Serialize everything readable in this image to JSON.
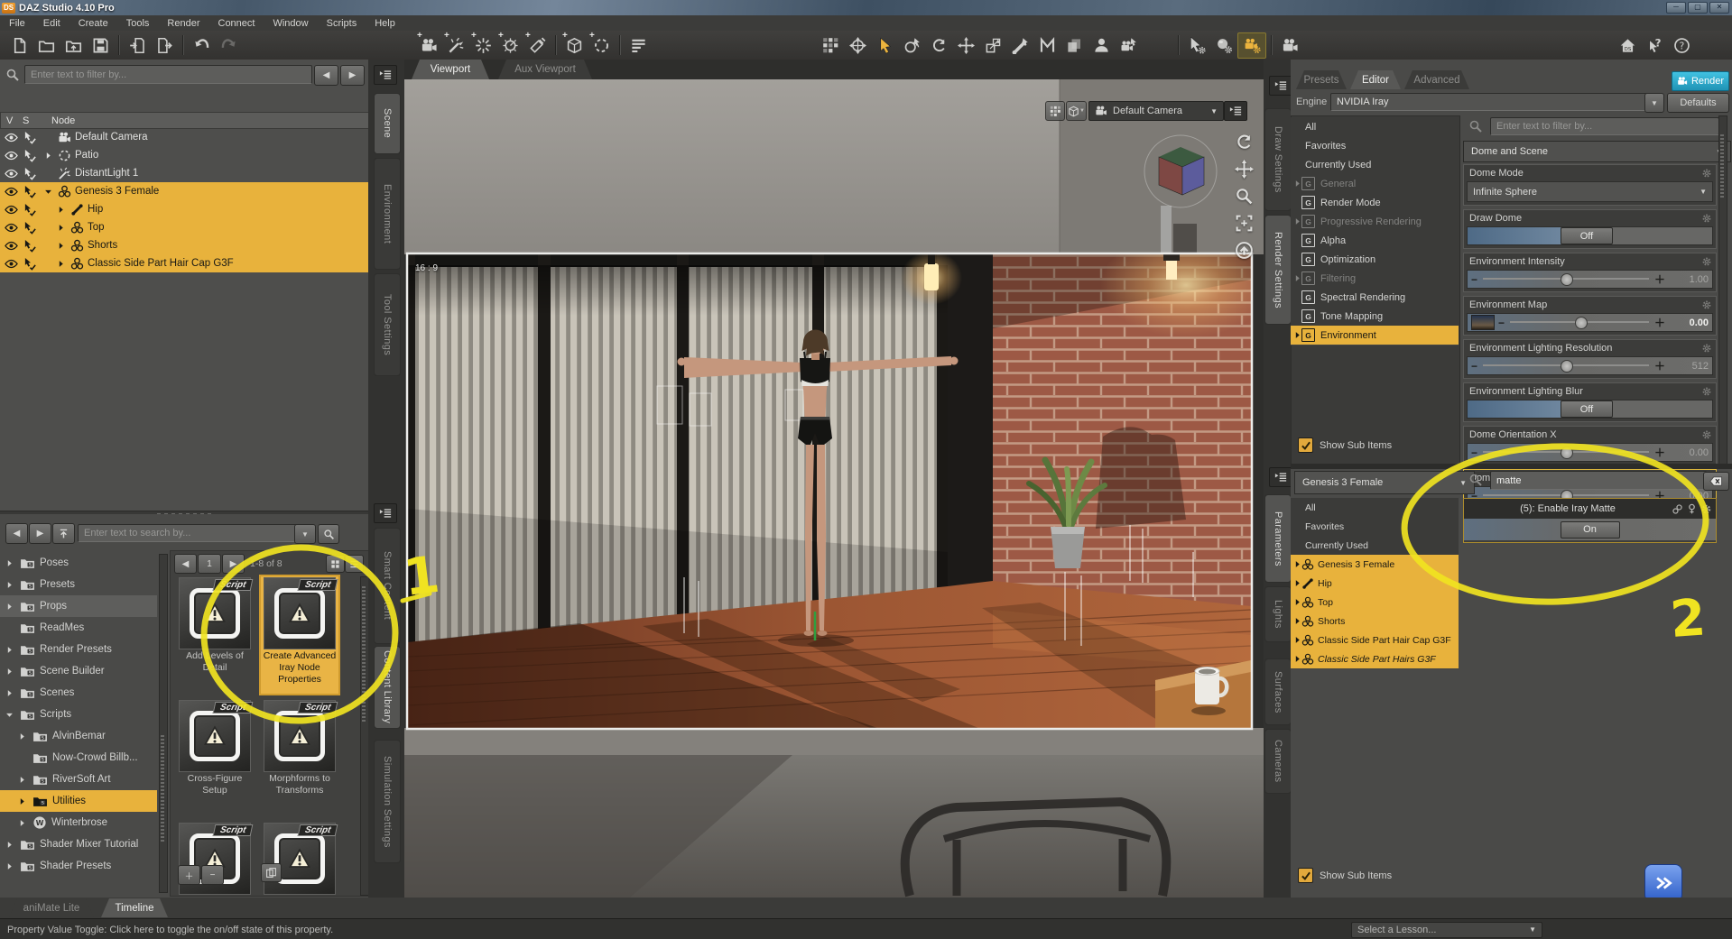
{
  "window": {
    "title": "DAZ Studio 4.10 Pro",
    "badge": "DS"
  },
  "menubar": [
    "File",
    "Edit",
    "Create",
    "Tools",
    "Render",
    "Connect",
    "Window",
    "Scripts",
    "Help"
  ],
  "toolbar": {
    "file_icons": [
      {
        "name": "new-file-icon",
        "sym": "doc"
      },
      {
        "name": "open-file-icon",
        "sym": "folder"
      },
      {
        "name": "open-merge-icon",
        "sym": "folderadd"
      },
      {
        "name": "save-icon",
        "sym": "floppy"
      },
      {
        "name": "import-icon",
        "sym": "import"
      },
      {
        "name": "export-icon",
        "sym": "export"
      },
      {
        "name": "undo-icon",
        "sym": "undo"
      },
      {
        "name": "redo-icon",
        "sym": "redo",
        "disabled": true
      }
    ],
    "create_icons": [
      {
        "name": "new-camera-icon",
        "sym": "cam",
        "plus": true
      },
      {
        "name": "new-distant-light-icon",
        "sym": "dlight",
        "plus": true
      },
      {
        "name": "new-point-light-icon",
        "sym": "plight",
        "plus": true
      },
      {
        "name": "new-spotlight-icon",
        "sym": "slight",
        "plus": true
      },
      {
        "name": "new-linear-light-icon",
        "sym": "llight",
        "plus": true
      },
      {
        "name": "new-group-icon",
        "sym": "cube",
        "plus": true
      },
      {
        "name": "new-null-icon",
        "sym": "nullc",
        "plus": true
      },
      {
        "name": "scene-info-icon",
        "sym": "listbars"
      }
    ],
    "tool_icons": [
      {
        "name": "pixel-grid-icon",
        "sym": "grid"
      },
      {
        "name": "universal-tool-icon",
        "sym": "globe"
      },
      {
        "name": "node-selection-tool-icon",
        "sym": "cursor",
        "active": true
      },
      {
        "name": "rotate-tool-icon",
        "sym": "orbitcur"
      },
      {
        "name": "twist-tool-icon",
        "sym": "rotcur"
      },
      {
        "name": "translate-tool-icon",
        "sym": "movecur"
      },
      {
        "name": "scale-tool-icon",
        "sym": "scalecur"
      },
      {
        "name": "joint-editor-tool-icon",
        "sym": "bonecur"
      },
      {
        "name": "polygon-group-tool-icon",
        "sym": "mtool"
      },
      {
        "name": "geometry-editor-tool-icon",
        "sym": "layers"
      },
      {
        "name": "figure-setup-icon",
        "sym": "person"
      },
      {
        "name": "spot-render-tool-icon",
        "sym": "camcur"
      }
    ],
    "settings_icons": [
      {
        "name": "tool-settings-icon",
        "sym": "cursorgear"
      },
      {
        "name": "iray-preview-icon",
        "sym": "spheregear"
      },
      {
        "name": "render-settings-icon",
        "sym": "camgear",
        "active": true
      },
      {
        "name": "render-frame-icon",
        "sym": "cam"
      }
    ],
    "help_icons": [
      {
        "name": "daz-central-icon",
        "sym": "home"
      },
      {
        "name": "whats-this-icon",
        "sym": "curq"
      },
      {
        "name": "help-icon",
        "sym": "help"
      }
    ]
  },
  "side_tabs": {
    "scene_group": [
      {
        "label": "Scene",
        "active": true
      },
      {
        "label": "Environment",
        "active": false
      },
      {
        "label": "Tool Settings",
        "active": false
      }
    ],
    "content_group": [
      {
        "label": "Smart Content",
        "active": false
      },
      {
        "label": "Content Library",
        "active": true
      },
      {
        "label": "Simulation Settings",
        "active": false
      }
    ],
    "draw_group": [
      {
        "label": "Draw Settings",
        "active": false
      },
      {
        "label": "Render Settings",
        "active": true
      }
    ],
    "param_group": [
      {
        "label": "Parameters",
        "active": true
      },
      {
        "label": "Lights",
        "active": false
      },
      {
        "label": "Surfaces",
        "active": false
      },
      {
        "label": "Cameras",
        "active": false
      }
    ]
  },
  "scene_pane": {
    "filter_placeholder": "Enter text to filter by...",
    "columns": {
      "v": "V",
      "s": "S",
      "node": "Node"
    },
    "nodes": [
      {
        "label": "Default Camera",
        "icon": "camera-icon",
        "expand": "",
        "depth": 0,
        "selected": false
      },
      {
        "label": "Patio",
        "icon": "null-icon",
        "expand": "r",
        "depth": 0,
        "selected": false
      },
      {
        "label": "DistantLight 1",
        "icon": "distant-light-icon",
        "expand": "",
        "depth": 0,
        "selected": false
      },
      {
        "label": "Genesis 3 Female",
        "icon": "figure-icon",
        "expand": "d",
        "depth": 0,
        "selected": true
      },
      {
        "label": "Hip",
        "icon": "bone-icon",
        "expand": "r",
        "depth": 1,
        "selected": true
      },
      {
        "label": "Top",
        "icon": "figure-icon",
        "expand": "r",
        "depth": 1,
        "selected": true
      },
      {
        "label": "Shorts",
        "icon": "figure-icon",
        "expand": "r",
        "depth": 1,
        "selected": true
      },
      {
        "label": "Classic Side Part Hair Cap G3F",
        "icon": "figure-icon",
        "expand": "r",
        "depth": 1,
        "selected": true
      }
    ]
  },
  "content_pane": {
    "search_placeholder": "Enter text to search by...",
    "folders": [
      {
        "label": "Poses",
        "expand": "r",
        "depth": 0
      },
      {
        "label": "Presets",
        "expand": "r",
        "depth": 0
      },
      {
        "label": "Props",
        "expand": "r",
        "depth": 0,
        "current": true
      },
      {
        "label": "ReadMes",
        "expand": "",
        "depth": 0
      },
      {
        "label": "Render Presets",
        "expand": "r",
        "depth": 0
      },
      {
        "label": "Scene Builder",
        "expand": "r",
        "depth": 0
      },
      {
        "label": "Scenes",
        "expand": "r",
        "depth": 0
      },
      {
        "label": "Scripts",
        "expand": "d",
        "depth": 0
      },
      {
        "label": "AlvinBemar",
        "expand": "r",
        "depth": 1
      },
      {
        "label": "Now-Crowd Billb...",
        "expand": "",
        "depth": 1
      },
      {
        "label": "RiverSoft Art",
        "expand": "r",
        "depth": 1
      },
      {
        "label": "Utilities",
        "expand": "r",
        "depth": 1,
        "selected": true
      },
      {
        "label": "Winterbrose",
        "expand": "r",
        "depth": 1,
        "logo": "W"
      },
      {
        "label": "Shader Mixer Tutorial",
        "expand": "r",
        "depth": 0
      },
      {
        "label": "Shader Presets",
        "expand": "r",
        "depth": 0
      }
    ],
    "pagination": {
      "page": "1",
      "range": "1-8 of 8"
    },
    "items": [
      {
        "caption": "Add Levels of Detail",
        "badge": "Script",
        "selected": false
      },
      {
        "caption": "Create Advanced Iray Node Properties",
        "badge": "Script",
        "selected": true
      },
      {
        "caption": "Cross-Figure Setup",
        "badge": "Script",
        "selected": false
      },
      {
        "caption": "Morphforms to Transforms",
        "badge": "Script",
        "selected": false
      },
      {
        "caption": "",
        "badge": "Script",
        "selected": false
      },
      {
        "caption": "",
        "badge": "Script",
        "selected": false
      }
    ]
  },
  "viewport": {
    "tabs": [
      {
        "label": "Viewport",
        "active": true
      },
      {
        "label": "Aux Viewport",
        "active": false
      }
    ],
    "camera_selector": "Default Camera",
    "aspect_label": "16 : 9"
  },
  "render_pane": {
    "tabs": [
      {
        "label": "Presets",
        "active": false
      },
      {
        "label": "Editor",
        "active": true
      },
      {
        "label": "Advanced",
        "active": false
      }
    ],
    "render_button": "Render",
    "engine_label": "Engine :",
    "engine_value": "NVIDIA Iray",
    "defaults_button": "Defaults",
    "filter_placeholder": "Enter text to filter by...",
    "categories": [
      {
        "label": "All",
        "g": false
      },
      {
        "label": "Favorites",
        "g": false
      },
      {
        "label": "Currently Used",
        "g": false
      },
      {
        "label": "General",
        "g": true,
        "disabled": true,
        "expand": true
      },
      {
        "label": "Render Mode",
        "g": true
      },
      {
        "label": "Progressive Rendering",
        "g": true,
        "disabled": true,
        "expand": true
      },
      {
        "label": "Alpha",
        "g": true
      },
      {
        "label": "Optimization",
        "g": true
      },
      {
        "label": "Filtering",
        "g": true,
        "disabled": true,
        "expand": true
      },
      {
        "label": "Spectral Rendering",
        "g": true
      },
      {
        "label": "Tone Mapping",
        "g": true
      },
      {
        "label": "Environment",
        "g": true,
        "selected": true,
        "expand": true
      }
    ],
    "show_sub_items": "Show Sub Items",
    "group_header": "Dome and Scene",
    "properties": [
      {
        "name": "Dome Mode",
        "type": "dropdown",
        "value": "Infinite Sphere"
      },
      {
        "name": "Draw Dome",
        "type": "toggle",
        "value": "Off"
      },
      {
        "name": "Environment Intensity",
        "type": "slider",
        "value": "1.00",
        "strong": false
      },
      {
        "name": "Environment Map",
        "type": "slider-map",
        "value": "0.00",
        "strong": true
      },
      {
        "name": "Environment Lighting Resolution",
        "type": "slider",
        "value": "512",
        "strong": false
      },
      {
        "name": "Environment Lighting Blur",
        "type": "toggle",
        "value": "Off"
      },
      {
        "name": "Dome Orientation X",
        "type": "slider",
        "value": "0.00",
        "strong": false
      },
      {
        "name": "Dome Orientation Y",
        "type": "slider",
        "value": "0.00",
        "strong": false,
        "selected": true
      }
    ]
  },
  "parameters_pane": {
    "node_selector": "Genesis 3 Female",
    "categories": [
      {
        "label": "All",
        "selected": false
      },
      {
        "label": "Favorites",
        "selected": false
      },
      {
        "label": "Currently Used",
        "selected": false
      },
      {
        "label": "Genesis 3 Female",
        "icon": "figure-icon",
        "selected": true
      },
      {
        "label": "Hip",
        "icon": "bone-icon",
        "selected": true
      },
      {
        "label": "Top",
        "icon": "figure-icon",
        "selected": true
      },
      {
        "label": "Shorts",
        "icon": "figure-icon",
        "selected": true
      },
      {
        "label": "Classic Side Part Hair Cap G3F",
        "icon": "figure-icon",
        "selected": true
      },
      {
        "label": "Classic Side Part Hairs G3F",
        "icon": "figure-icon",
        "selected": true,
        "italic": true
      }
    ],
    "search_value": "matte",
    "result": {
      "header": "(5): Enable Iray Matte",
      "value_button": "On"
    },
    "show_sub_items": "Show Sub Items"
  },
  "bottom_bar": {
    "tabs": [
      {
        "label": "aniMate Lite",
        "active": false
      },
      {
        "label": "Timeline",
        "active": true
      }
    ],
    "status": "Property Value Toggle: Click here to toggle the on/off state of this property.",
    "lesson_selector": "Select a Lesson..."
  },
  "annotations": {
    "mark1": "1",
    "mark2": "2"
  },
  "colors": {
    "highlight": "#e8b23c",
    "render_button": "#2ba6c9",
    "annotation": "#f0e321",
    "selection_border": "#cf9b2e"
  }
}
